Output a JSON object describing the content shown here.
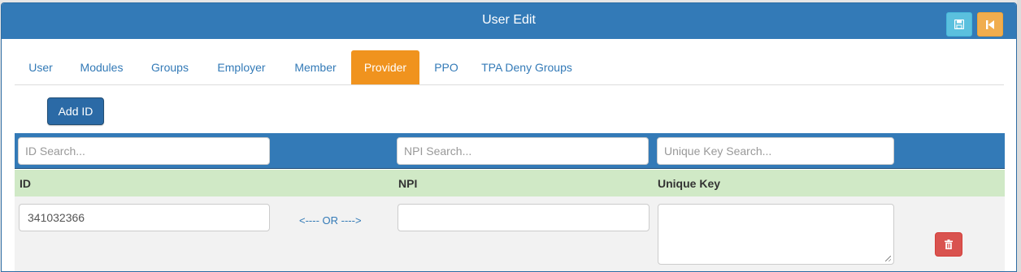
{
  "header": {
    "title": "User Edit",
    "save_icon": "floppy-disk-icon",
    "back_icon": "step-backward-icon"
  },
  "tabs": [
    {
      "label": "User",
      "active": false
    },
    {
      "label": "Modules",
      "active": false
    },
    {
      "label": "Groups",
      "active": false
    },
    {
      "label": "Employer",
      "active": false
    },
    {
      "label": "Member",
      "active": false
    },
    {
      "label": "Provider",
      "active": true
    },
    {
      "label": "PPO",
      "active": false
    },
    {
      "label": "TPA Deny Groups",
      "active": false
    }
  ],
  "add_button": {
    "label": "Add ID"
  },
  "search": {
    "id_placeholder": "ID Search...",
    "npi_placeholder": "NPI Search...",
    "unique_key_placeholder": "Unique Key Search..."
  },
  "columns": {
    "id": "ID",
    "npi": "NPI",
    "unique_key": "Unique Key"
  },
  "rows": [
    {
      "id_value": "341032366",
      "or_text": "<---- OR ---->",
      "npi_value": "",
      "unique_key_value": "",
      "delete_icon": "trash-icon"
    }
  ],
  "colors": {
    "header": "#337ab7",
    "active_tab": "#f0931e",
    "table_header": "#d0e9c6",
    "delete": "#d9534f",
    "save": "#5bc0de",
    "back": "#f0ad4e"
  }
}
